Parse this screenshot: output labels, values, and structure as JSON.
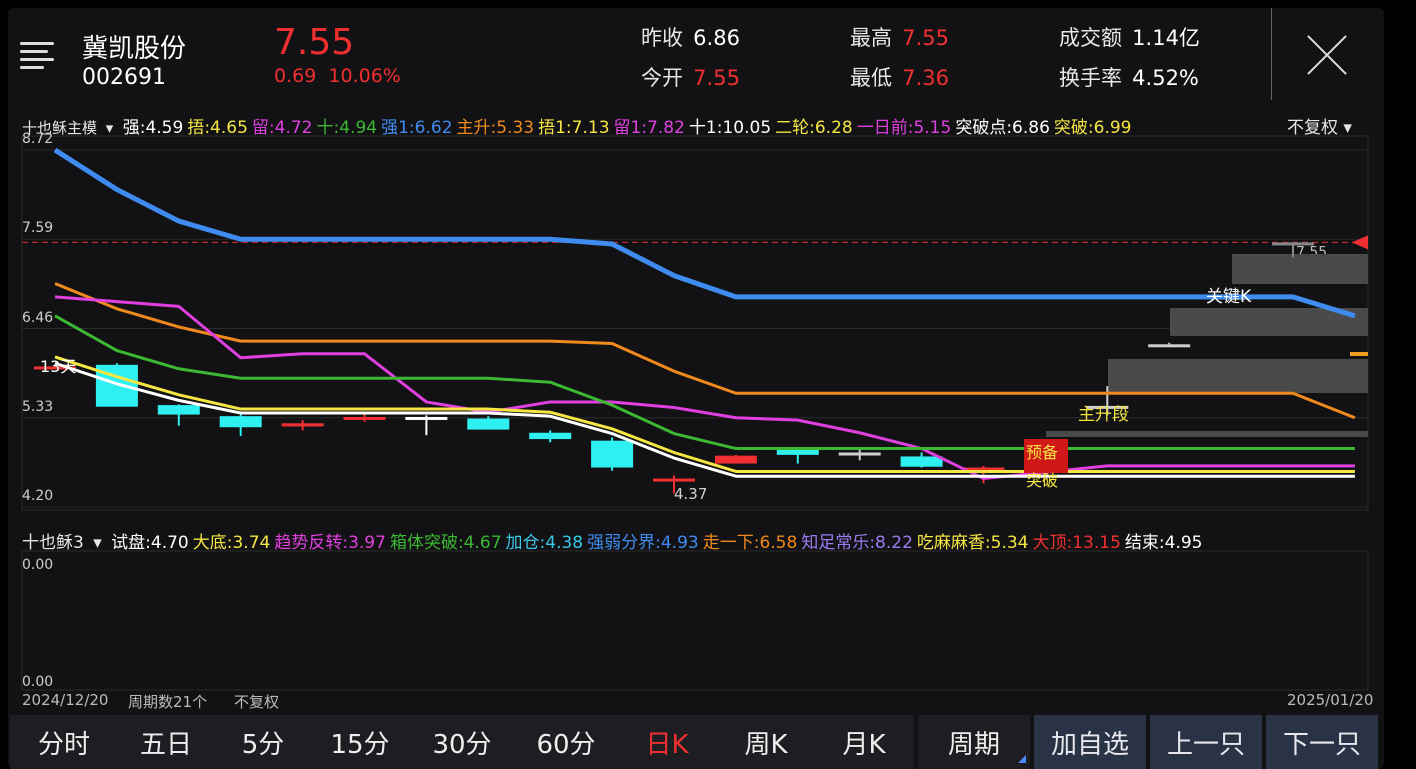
{
  "header": {
    "stock_name": "冀凯股份",
    "stock_code": "002691",
    "price": "7.55",
    "change": "0.69",
    "change_pct": "10.06%",
    "stats": [
      {
        "label": "昨收",
        "value": "6.86",
        "color": "#ffffff"
      },
      {
        "label": "今开",
        "value": "7.55",
        "color": "#f03030"
      },
      {
        "label": "最高",
        "value": "7.55",
        "color": "#f03030"
      },
      {
        "label": "最低",
        "value": "7.36",
        "color": "#f03030"
      },
      {
        "label": "成交额",
        "value": "1.14亿",
        "color": "#ffffff"
      },
      {
        "label": "换手率",
        "value": "4.52%",
        "color": "#ffffff"
      }
    ]
  },
  "main_indicator": {
    "name": "十也稣主模",
    "items": [
      {
        "text": "强:4.59",
        "color": "#ffffff"
      },
      {
        "text": "捂:4.65",
        "color": "#f5e642"
      },
      {
        "text": "留:4.72",
        "color": "#e040e0"
      },
      {
        "text": "十:4.94",
        "color": "#3cb832"
      },
      {
        "text": "强1:6.62",
        "color": "#3f8cf0"
      },
      {
        "text": "主升:5.33",
        "color": "#f08a1e"
      },
      {
        "text": "捂1:7.13",
        "color": "#f5e642"
      },
      {
        "text": "留1:7.82",
        "color": "#e040e0"
      },
      {
        "text": "十1:10.05",
        "color": "#ffffff"
      },
      {
        "text": "二轮:6.28",
        "color": "#f5e642"
      },
      {
        "text": "一日前:5.15",
        "color": "#e040e0"
      },
      {
        "text": "突破点:6.86",
        "color": "#ffffff"
      },
      {
        "text": "突破:6.99",
        "color": "#f5e642"
      }
    ],
    "restore": "不复权"
  },
  "sub_indicator": {
    "name": "十也稣3",
    "items": [
      {
        "text": "试盘:4.70",
        "color": "#ffffff"
      },
      {
        "text": "大底:3.74",
        "color": "#f5e642"
      },
      {
        "text": "趋势反转:3.97",
        "color": "#e040e0"
      },
      {
        "text": "箱体突破:4.67",
        "color": "#3cb832"
      },
      {
        "text": "加仓:4.38",
        "color": "#38c8e8"
      },
      {
        "text": "强弱分界:4.93",
        "color": "#3f8cf0"
      },
      {
        "text": "走一下:6.58",
        "color": "#f08a1e"
      },
      {
        "text": "知足常乐:8.22",
        "color": "#9a7cf0"
      },
      {
        "text": "吃麻麻香:5.34",
        "color": "#f5e642"
      },
      {
        "text": "大顶:13.15",
        "color": "#f03030"
      },
      {
        "text": "结束:4.95",
        "color": "#ffffff"
      }
    ],
    "y_top": "0.00",
    "y_bottom": "0.00"
  },
  "chart_data": {
    "type": "candlestick",
    "y_ticks": [
      "8.72",
      "7.59",
      "6.46",
      "5.33",
      "4.20"
    ],
    "ylim": [
      4.2,
      8.72
    ],
    "last_price": "7.55",
    "min_label": "4.37",
    "annotations": {
      "start": "13天",
      "key_k": "关键K",
      "main_rise": "主升段",
      "prepare": "预备",
      "breakout": "突破"
    },
    "series": [
      {
        "name": "强1",
        "color": "#3f8cf0",
        "values": [
          8.72,
          8.22,
          7.82,
          7.59,
          7.59,
          7.59,
          7.59,
          7.59,
          7.59,
          7.53,
          7.13,
          6.86,
          6.86,
          6.86,
          6.86,
          6.86,
          6.86,
          6.86,
          6.86,
          6.86,
          6.86,
          6.62
        ]
      },
      {
        "name": "主升",
        "color": "#f08a1e",
        "values": [
          7.03,
          6.71,
          6.48,
          6.3,
          6.3,
          6.3,
          6.3,
          6.3,
          6.3,
          6.27,
          5.92,
          5.64,
          5.64,
          5.64,
          5.64,
          5.64,
          5.64,
          5.64,
          5.64,
          5.64,
          5.64,
          5.33
        ]
      },
      {
        "name": "留",
        "color": "#e040e0",
        "values": [
          6.86,
          6.8,
          6.74,
          6.09,
          6.14,
          6.14,
          5.53,
          5.4,
          5.53,
          5.53,
          5.46,
          5.33,
          5.3,
          5.14,
          4.94,
          4.56,
          4.64,
          4.72,
          4.72,
          4.72,
          4.72,
          4.72
        ]
      },
      {
        "name": "十",
        "color": "#3cb832",
        "values": [
          6.62,
          6.18,
          5.95,
          5.83,
          5.83,
          5.83,
          5.83,
          5.83,
          5.78,
          5.49,
          5.13,
          4.94,
          4.94,
          4.94,
          4.94,
          4.94,
          4.94,
          4.94,
          4.94,
          4.94,
          4.94,
          4.94
        ]
      },
      {
        "name": "捂",
        "color": "#f5e642",
        "values": [
          6.1,
          5.85,
          5.62,
          5.44,
          5.44,
          5.44,
          5.44,
          5.44,
          5.4,
          5.19,
          4.89,
          4.65,
          4.65,
          4.65,
          4.65,
          4.65,
          4.65,
          4.65,
          4.65,
          4.65,
          4.65,
          4.65
        ]
      },
      {
        "name": "强",
        "color": "#ffffff",
        "values": [
          6.02,
          5.76,
          5.55,
          5.39,
          5.39,
          5.39,
          5.39,
          5.39,
          5.35,
          5.13,
          4.82,
          4.59,
          4.59,
          4.59,
          4.59,
          4.59,
          4.59,
          4.59,
          4.59,
          4.59,
          4.59,
          4.59
        ]
      }
    ],
    "candles": [
      {
        "o": 5.98,
        "h": 6.0,
        "l": 5.96,
        "c": 5.95,
        "color": "#f03030"
      },
      {
        "o": 6.0,
        "h": 6.02,
        "l": 5.48,
        "c": 5.47,
        "color": "#2ff0f0"
      },
      {
        "o": 5.49,
        "h": 5.5,
        "l": 5.23,
        "c": 5.37,
        "color": "#2ff0f0"
      },
      {
        "o": 5.35,
        "h": 5.38,
        "l": 5.1,
        "c": 5.21,
        "color": "#2ff0f0"
      },
      {
        "o": 5.26,
        "h": 5.3,
        "l": 5.17,
        "c": 5.22,
        "color": "#f03030"
      },
      {
        "o": 5.34,
        "h": 5.41,
        "l": 5.28,
        "c": 5.34,
        "color": "#f03030"
      },
      {
        "o": 5.34,
        "h": 5.36,
        "l": 5.11,
        "c": 5.31,
        "color": "#ffffff"
      },
      {
        "o": 5.32,
        "h": 5.35,
        "l": 5.18,
        "c": 5.18,
        "color": "#2ff0f0"
      },
      {
        "o": 5.14,
        "h": 5.17,
        "l": 5.02,
        "c": 5.06,
        "color": "#2ff0f0"
      },
      {
        "o": 5.04,
        "h": 5.08,
        "l": 4.66,
        "c": 4.7,
        "color": "#2ff0f0"
      },
      {
        "o": 4.56,
        "h": 4.6,
        "l": 4.37,
        "c": 4.56,
        "color": "#f03030"
      },
      {
        "o": 4.85,
        "h": 4.86,
        "l": 4.75,
        "c": 4.75,
        "color": "#f03030"
      },
      {
        "o": 4.93,
        "h": 4.94,
        "l": 4.75,
        "c": 4.86,
        "color": "#2ff0f0"
      },
      {
        "o": 4.89,
        "h": 4.93,
        "l": 4.79,
        "c": 4.89,
        "color": "#cfcfcf"
      },
      {
        "o": 4.84,
        "h": 4.89,
        "l": 4.7,
        "c": 4.71,
        "color": "#2ff0f0"
      },
      {
        "o": 4.7,
        "h": 4.72,
        "l": 4.5,
        "c": 4.7,
        "color": "#f03030"
      },
      {
        "o": 4.85,
        "h": 4.9,
        "l": 4.7,
        "c": 5.0,
        "color": "#f03030"
      },
      {
        "o": 5.48,
        "h": 5.73,
        "l": 5.36,
        "c": 5.48,
        "color": "#cfcfcf"
      },
      {
        "o": 6.26,
        "h": 6.28,
        "l": 6.26,
        "c": 6.26,
        "color": "#cfcfcf"
      },
      {
        "o": 6.86,
        "h": 6.86,
        "l": 6.86,
        "c": 6.86,
        "color": "#555555"
      },
      {
        "o": 7.55,
        "h": 7.55,
        "l": 7.36,
        "c": 7.55,
        "color": "#888888"
      }
    ]
  },
  "footer": {
    "start_date": "2024/12/20",
    "period_count": "周期数21个",
    "restore": "不复权",
    "end_date": "2025/01/20"
  },
  "tabs": {
    "periods": [
      "分时",
      "五日",
      "5分",
      "15分",
      "30分",
      "60分",
      "日K",
      "周K",
      "月K"
    ],
    "active": "日K",
    "period_menu": "周期",
    "add_watch": "加自选",
    "prev": "上一只",
    "next": "下一只"
  }
}
